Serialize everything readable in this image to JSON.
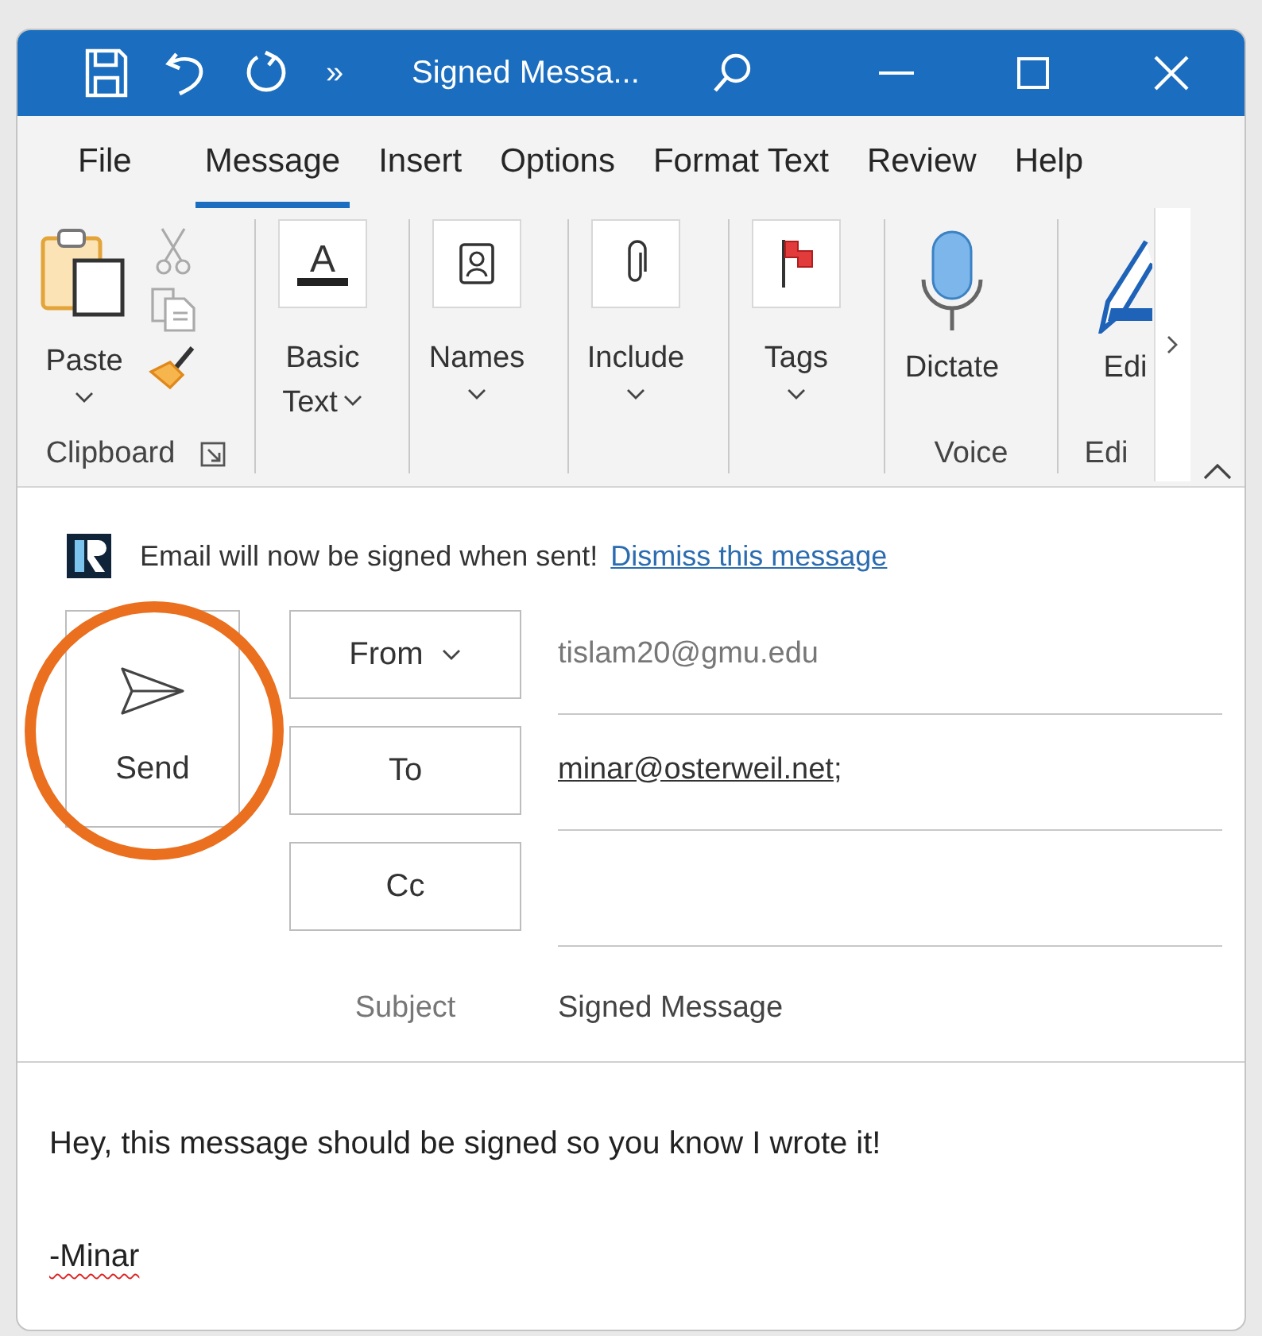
{
  "window": {
    "title": "Signed Messa...",
    "overflow": "»",
    "quick_access": [
      {
        "kind": "save"
      },
      {
        "kind": "undo"
      },
      {
        "kind": "redo"
      }
    ]
  },
  "tabs": [
    {
      "label": "File",
      "selected": false
    },
    {
      "label": "Message",
      "selected": true
    },
    {
      "label": "Insert",
      "selected": false
    },
    {
      "label": "Options",
      "selected": false
    },
    {
      "label": "Format Text",
      "selected": false
    },
    {
      "label": "Review",
      "selected": false
    },
    {
      "label": "Help",
      "selected": false
    }
  ],
  "ribbon": {
    "groups": [
      {
        "label": "Clipboard",
        "launcher": true,
        "buttons": [
          {
            "kind": "paste",
            "lines": [
              "Paste"
            ],
            "dropdown": true
          }
        ],
        "small_tools": [
          {
            "kind": "cut"
          },
          {
            "kind": "copy"
          },
          {
            "kind": "painter"
          }
        ]
      },
      {
        "buttons": [
          {
            "kind": "font",
            "glyph": "A",
            "lines": [
              "Basic",
              "Text"
            ],
            "dropdown": true
          }
        ]
      },
      {
        "buttons": [
          {
            "kind": "names",
            "lines": [
              "Names"
            ],
            "dropdown": true
          }
        ]
      },
      {
        "buttons": [
          {
            "kind": "attach",
            "lines": [
              "Include"
            ],
            "dropdown": true
          }
        ]
      },
      {
        "buttons": [
          {
            "kind": "flag",
            "lines": [
              "Tags"
            ],
            "dropdown": true
          }
        ]
      },
      {
        "label": "Voice",
        "launcher": false,
        "buttons": [
          {
            "kind": "mic",
            "lines": [
              "Dictate"
            ],
            "dropdown": false
          }
        ]
      },
      {
        "label": "Edi",
        "launcher": false,
        "buttons": [
          {
            "kind": "pen",
            "lines": [
              "Edi"
            ],
            "dropdown": false
          }
        ]
      }
    ]
  },
  "notice": {
    "text": "Email will now be signed when sent!",
    "link": "Dismiss this message"
  },
  "header": {
    "send": {
      "label": "Send"
    },
    "fields": [
      {
        "kind": "account",
        "label": "From",
        "dropdown": true,
        "value": "tislam20@gmu.edu"
      },
      {
        "kind": "recipients",
        "label": "To",
        "dropdown": false,
        "recipients": [
          "minar@osterweil.net"
        ],
        "separator": ";"
      },
      {
        "kind": "recipients",
        "label": "Cc",
        "dropdown": false
      }
    ],
    "subject": {
      "label": "Subject",
      "value": "Signed Message"
    }
  },
  "body": {
    "lines": [
      {
        "text": "Hey, this message should be signed so you know I wrote it!",
        "misspelled": false
      },
      {
        "text": "-Minar",
        "misspelled": true
      }
    ]
  }
}
